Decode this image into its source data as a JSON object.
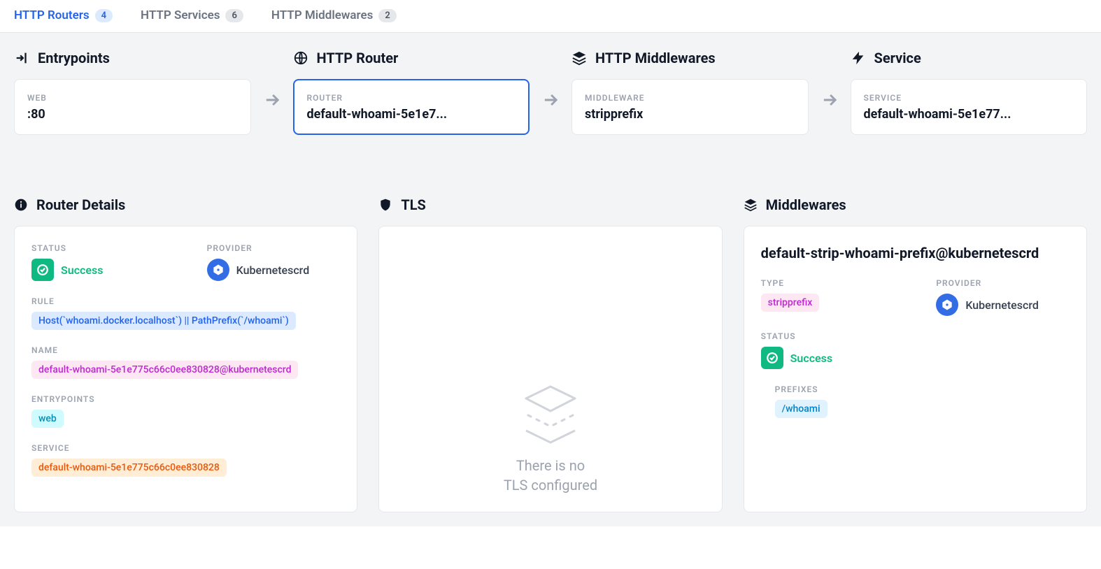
{
  "tabs": [
    {
      "label": "HTTP Routers",
      "count": "4",
      "active": true
    },
    {
      "label": "HTTP Services",
      "count": "6",
      "active": false
    },
    {
      "label": "HTTP Middlewares",
      "count": "2",
      "active": false
    }
  ],
  "flow": {
    "entrypoints": {
      "title": "Entrypoints",
      "card_label": "WEB",
      "card_value": ":80"
    },
    "router": {
      "title": "HTTP Router",
      "card_label": "ROUTER",
      "card_value": "default-whoami-5e1e7..."
    },
    "middlewares": {
      "title": "HTTP Middlewares",
      "card_label": "MIDDLEWARE",
      "card_value": "stripprefix"
    },
    "service": {
      "title": "Service",
      "card_label": "SERVICE",
      "card_value": "default-whoami-5e1e77..."
    }
  },
  "router_details": {
    "title": "Router Details",
    "status_label": "STATUS",
    "status": "Success",
    "provider_label": "PROVIDER",
    "provider": "Kubernetescrd",
    "rule_label": "RULE",
    "rule": "Host(`whoami.docker.localhost`) || PathPrefix(`/whoami`)",
    "name_label": "NAME",
    "name": "default-whoami-5e1e775c66c0ee830828@kubernetescrd",
    "entrypoints_label": "ENTRYPOINTS",
    "entrypoint": "web",
    "service_label": "SERVICE",
    "service": "default-whoami-5e1e775c66c0ee830828"
  },
  "tls": {
    "title": "TLS",
    "empty_line1": "There is no",
    "empty_line2": "TLS configured"
  },
  "middlewares_panel": {
    "title": "Middlewares",
    "name": "default-strip-whoami-prefix@kubernetescrd",
    "type_label": "TYPE",
    "type": "stripprefix",
    "provider_label": "PROVIDER",
    "provider": "Kubernetescrd",
    "status_label": "STATUS",
    "status": "Success",
    "prefixes_label": "PREFIXES",
    "prefix": "/whoami"
  }
}
